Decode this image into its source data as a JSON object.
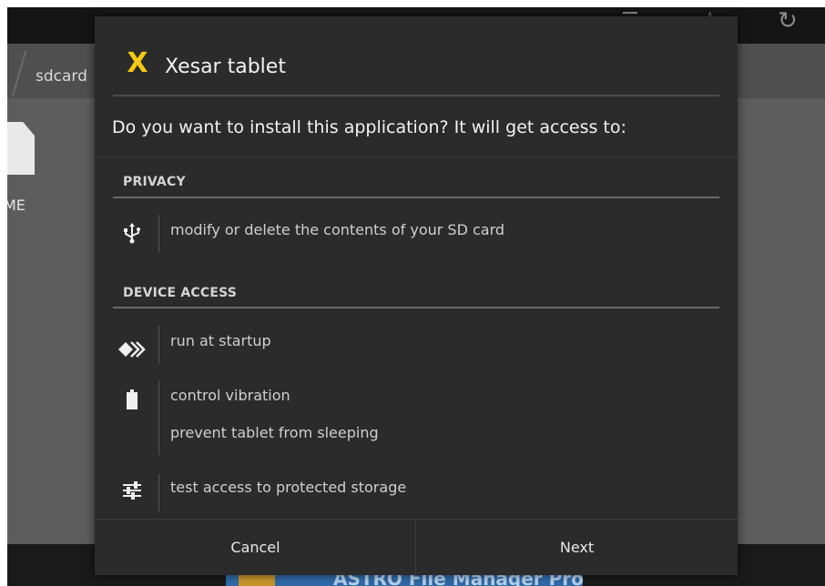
{
  "background_app": {
    "breadcrumb": "sdcard",
    "file_label": "ME",
    "ad_text": "ASTRO File Manager Pro",
    "toolbar_icons": [
      "list-view-icon",
      "favorite-icon",
      "refresh-icon"
    ]
  },
  "dialog": {
    "app_icon": "X",
    "app_title": "Xesar tablet",
    "question": "Do you want to install this application? It will get access to:",
    "sections": [
      {
        "header": "PRIVACY",
        "permissions": [
          {
            "icon": "usb-icon",
            "labels": [
              "modify or delete the contents of your SD card"
            ]
          }
        ]
      },
      {
        "header": "DEVICE ACCESS",
        "permissions": [
          {
            "icon": "startup-icon",
            "labels": [
              "run at startup"
            ]
          },
          {
            "icon": "battery-icon",
            "labels": [
              "control vibration",
              "prevent tablet from sleeping"
            ]
          },
          {
            "icon": "settings-sliders-icon",
            "labels": [
              "test access to protected storage"
            ]
          }
        ]
      }
    ],
    "buttons": {
      "cancel": "Cancel",
      "next": "Next"
    }
  },
  "colors": {
    "dialog_bg": "#2b2b2b",
    "app_icon_color": "#f6c913",
    "background_app": "#595959"
  }
}
